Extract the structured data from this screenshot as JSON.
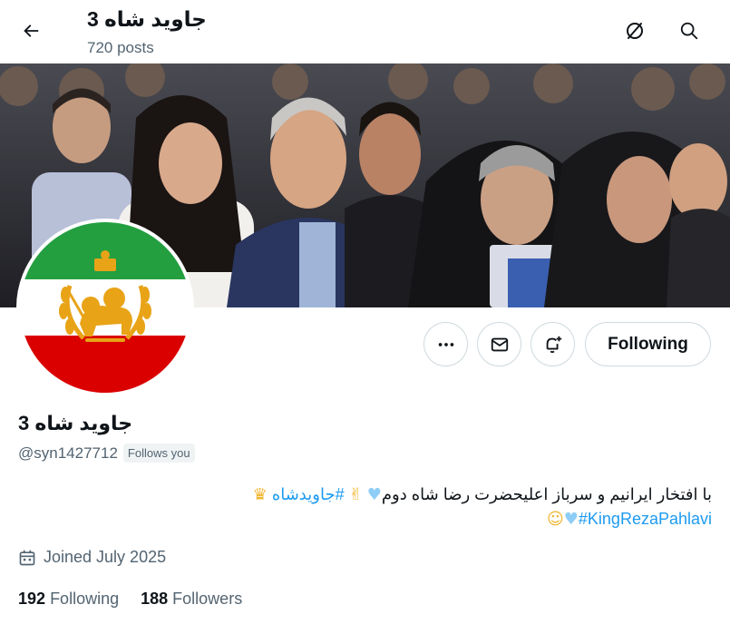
{
  "header": {
    "title": "جاوید شاه 3",
    "posts": "720 posts",
    "back_icon": "arrow-left-icon",
    "icons": [
      "grok-icon",
      "search-icon"
    ]
  },
  "banner": {
    "description_icon": "photo-banner"
  },
  "avatar": {
    "icon": "lion-and-sun-flag-icon",
    "colors": {
      "green": "#239f40",
      "white": "#ffffff",
      "red": "#da0000",
      "emblem": "#e8a317"
    }
  },
  "actions": {
    "more_icon": "more-icon",
    "message_icon": "envelope-icon",
    "notify_icon": "bell-plus-icon",
    "following_label": "Following"
  },
  "profile": {
    "name": "جاوید شاه 3",
    "handle": "@syn1427712",
    "follows_you": "Follows you",
    "bio_line1_text": "با افتخار ایرانیم و سرباز اعلیحضرت رضا شاه دوم",
    "bio_line1_hashtag": "#جاویدشاه",
    "bio_line2_hashtag": "#KingRezaPahlavi",
    "joined": "Joined July 2025",
    "following_count": "192",
    "following_label": "Following",
    "followers_count": "188",
    "followers_label": "Followers"
  },
  "colors": {
    "accent": "#1d9bf0",
    "muted": "#536471",
    "border": "#cfd9de"
  }
}
